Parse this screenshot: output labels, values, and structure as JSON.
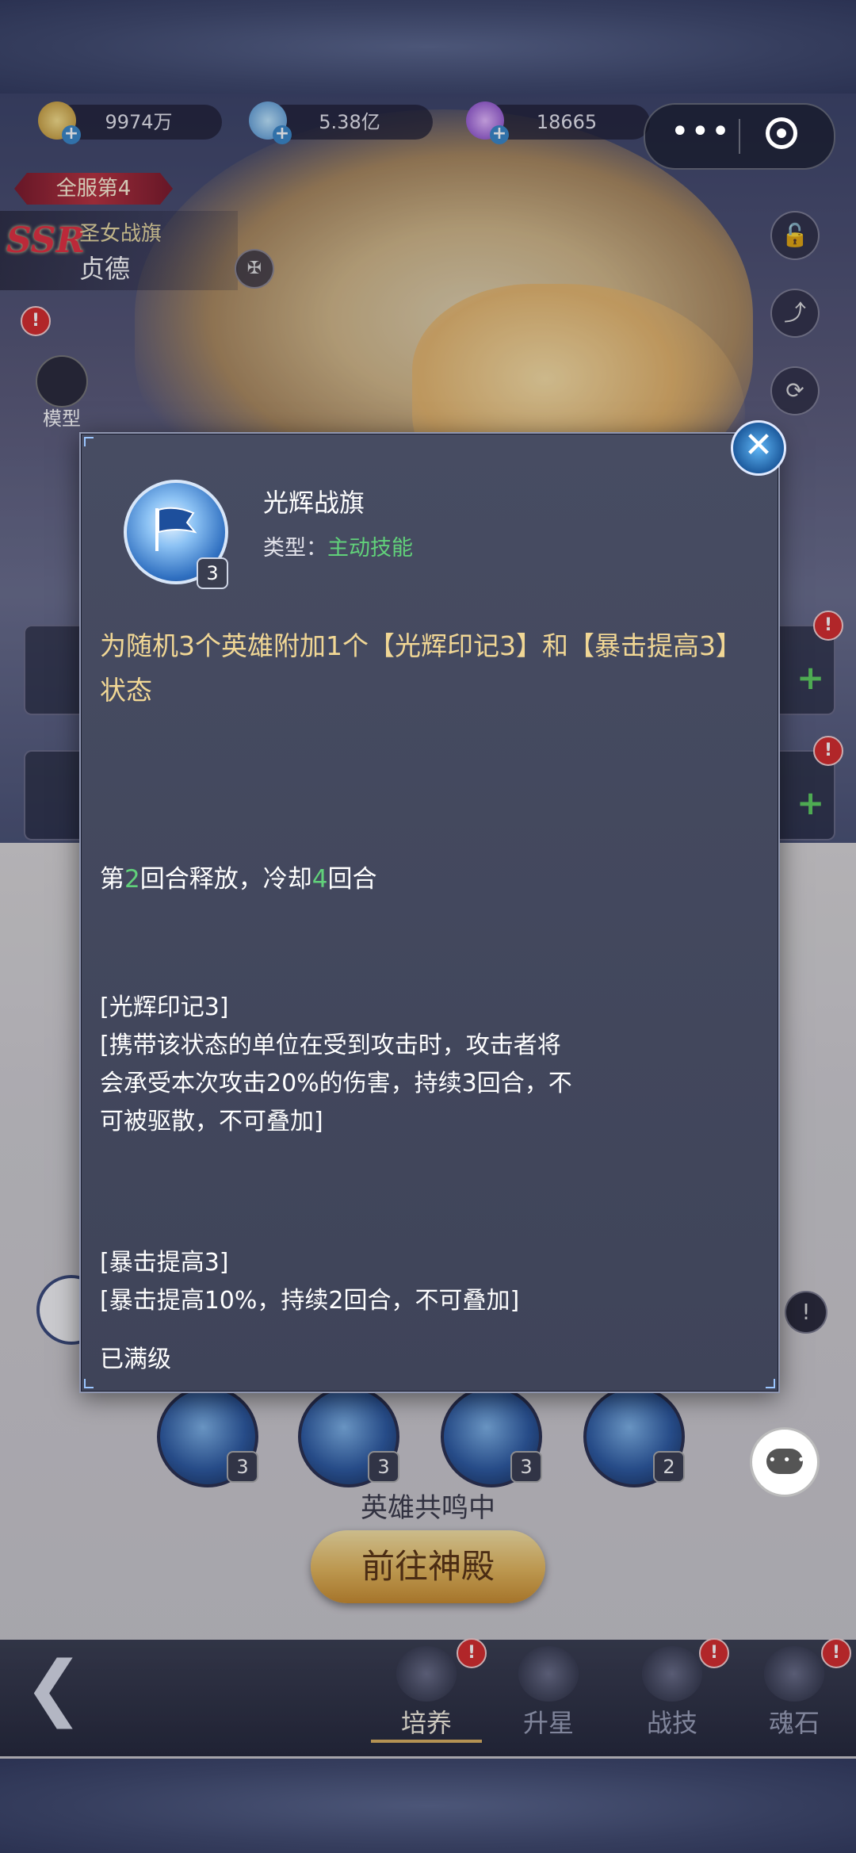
{
  "top_bar": {
    "resources": [
      {
        "icon": "gold-coin-icon",
        "value": "9974万"
      },
      {
        "icon": "potion-icon",
        "value": "5.38亿"
      },
      {
        "icon": "purple-crystal-icon",
        "value": "18665"
      }
    ]
  },
  "hero": {
    "rank_badge": "全服第4",
    "rarity": "SSR",
    "title": "圣女战旗",
    "name": "贞德",
    "model_label": "模型"
  },
  "skills_row": [
    {
      "level": "3"
    },
    {
      "level": "3"
    },
    {
      "level": "3"
    },
    {
      "level": "2"
    }
  ],
  "resonance_text": "英雄共鸣中",
  "temple_button": "前往神殿",
  "bottom_nav": {
    "items": [
      {
        "label": "培养",
        "active": true
      },
      {
        "label": "升星",
        "active": false
      },
      {
        "label": "战技",
        "active": false
      },
      {
        "label": "魂石",
        "active": false
      }
    ],
    "badge": "!"
  },
  "modal": {
    "skill_name": "光辉战旗",
    "type_label": "类型：",
    "type_value": "主动技能",
    "icon_level": "3",
    "description": "为随机3个英雄附加1个【光辉印记3】和【暴击提高3】状态",
    "cast": {
      "p1": "第",
      "turn": "2",
      "p2": "回合释放，冷却",
      "cooldown": "4",
      "p3": "回合"
    },
    "effects": [
      {
        "title": "[光辉印记3]",
        "lines": [
          "[携带该状态的单位在受到攻击时，攻击者将",
          "会承受本次攻击20%的伤害，持续3回合，不",
          "可被驱散，不可叠加]"
        ]
      },
      {
        "title": "[暴击提高3]",
        "lines": [
          "[暴击提高10%，持续2回合，不可叠加]"
        ]
      }
    ],
    "status": "已满级"
  },
  "colors": {
    "accent_green": "#61d17a",
    "desc_gold": "#f1d795",
    "badge_red": "#d62c2c"
  }
}
